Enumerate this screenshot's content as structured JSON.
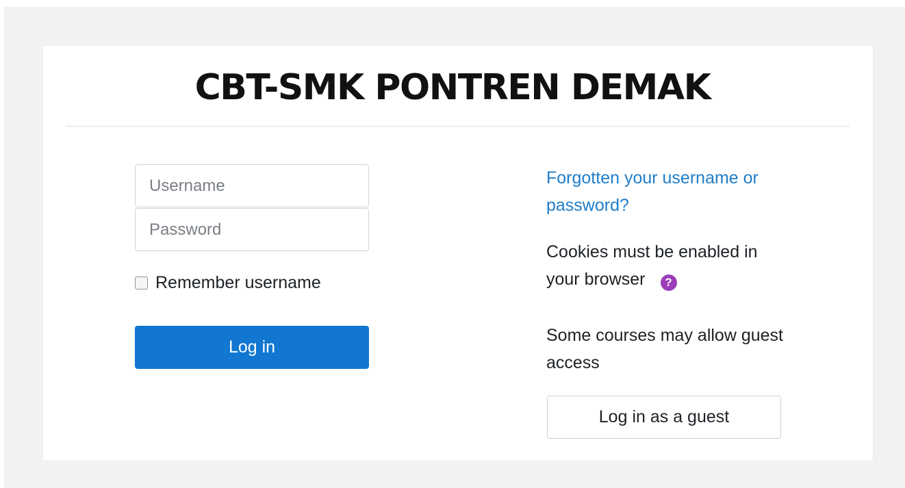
{
  "site": {
    "title": "CBT-SMK PONTREN DEMAK"
  },
  "login_form": {
    "username_placeholder": "Username",
    "password_placeholder": "Password",
    "remember_label": "Remember username",
    "remember_checked": false,
    "login_button": "Log in"
  },
  "side": {
    "forgot_link": "Forgotten your username or password?",
    "cookies_text": "Cookies must be enabled in your browser",
    "help_icon": "question-circle-icon",
    "guest_note": "Some courses may allow guest access",
    "guest_button": "Log in as a guest"
  },
  "colors": {
    "primary_button": "#1177d1",
    "link": "#1f7dc9",
    "help_icon": "#9b3db8",
    "page_background": "#f2f2f2"
  }
}
